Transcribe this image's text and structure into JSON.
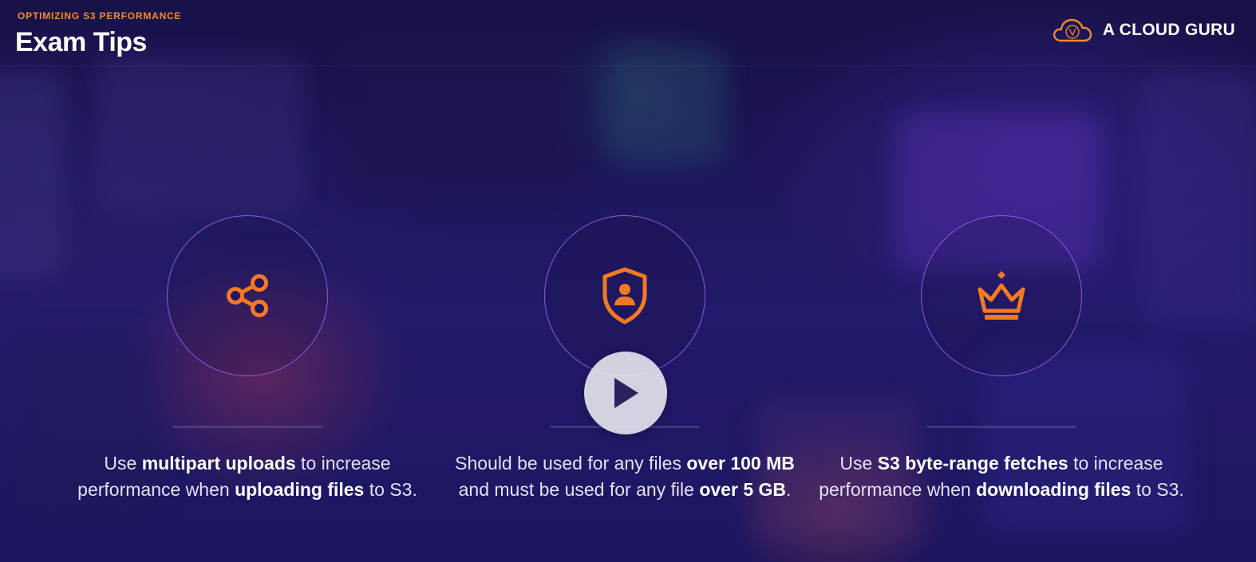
{
  "header": {
    "kicker": "OPTIMIZING S3 PERFORMANCE",
    "title": "Exam Tips"
  },
  "brand": {
    "name": "A CLOUD GURU",
    "icon": "cloud-logo-icon"
  },
  "colors": {
    "accent": "#f08a2c",
    "circle_border": "#8a5ce0",
    "background": "#1b1556"
  },
  "tips": [
    {
      "icon": "share-icon",
      "parts": [
        {
          "text": "Use ",
          "bold": false
        },
        {
          "text": "multipart uploads",
          "bold": true
        },
        {
          "text": " to increase performance when ",
          "bold": false
        },
        {
          "text": "uploading files",
          "bold": true
        },
        {
          "text": " to S3.",
          "bold": false
        }
      ]
    },
    {
      "icon": "shield-user-icon",
      "parts": [
        {
          "text": "Should be used for any files ",
          "bold": false
        },
        {
          "text": "over 100 MB",
          "bold": true
        },
        {
          "text": " and must be used for any file ",
          "bold": false
        },
        {
          "text": "over 5 GB",
          "bold": true
        },
        {
          "text": ".",
          "bold": false
        }
      ]
    },
    {
      "icon": "crown-icon",
      "parts": [
        {
          "text": "Use ",
          "bold": false
        },
        {
          "text": "S3 byte-range fetches",
          "bold": true
        },
        {
          "text": " to increase performance when ",
          "bold": false
        },
        {
          "text": "downloading files",
          "bold": true
        },
        {
          "text": " to S3.",
          "bold": false
        }
      ]
    }
  ],
  "player": {
    "icon": "play-icon"
  }
}
